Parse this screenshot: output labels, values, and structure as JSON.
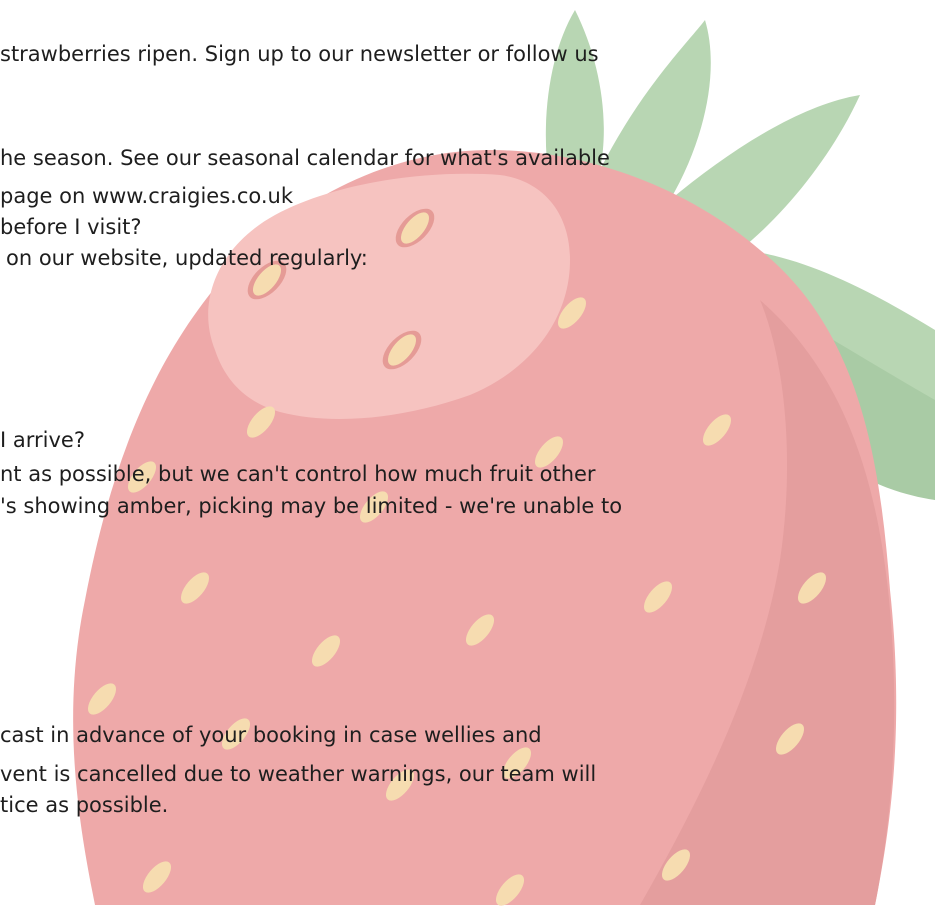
{
  "colors": {
    "berry_body": "#eea9a9",
    "berry_shade": "#e49e9e",
    "berry_highlight": "#f6c3c0",
    "seed": "#f6dcb0",
    "seed_rim": "#e59b96",
    "leaf": "#b8d6b3",
    "leaf_shade": "#a9cba5",
    "text": "#1e1e1e"
  },
  "text_lines": [
    "strawberries ripen. Sign up to our newsletter or follow us",
    "he season. See our seasonal calendar for what's available",
    "page on www.craigies.co.uk",
    "before I visit?",
    "on our website, updated regularly:",
    "I arrive?",
    "nt as possible, but we can't control how much fruit other",
    "'s showing amber, picking may be limited - we're unable to",
    "cast in advance of your booking in case wellies and",
    "vent is cancelled due to weather warnings, our team will",
    "tice as possible."
  ]
}
